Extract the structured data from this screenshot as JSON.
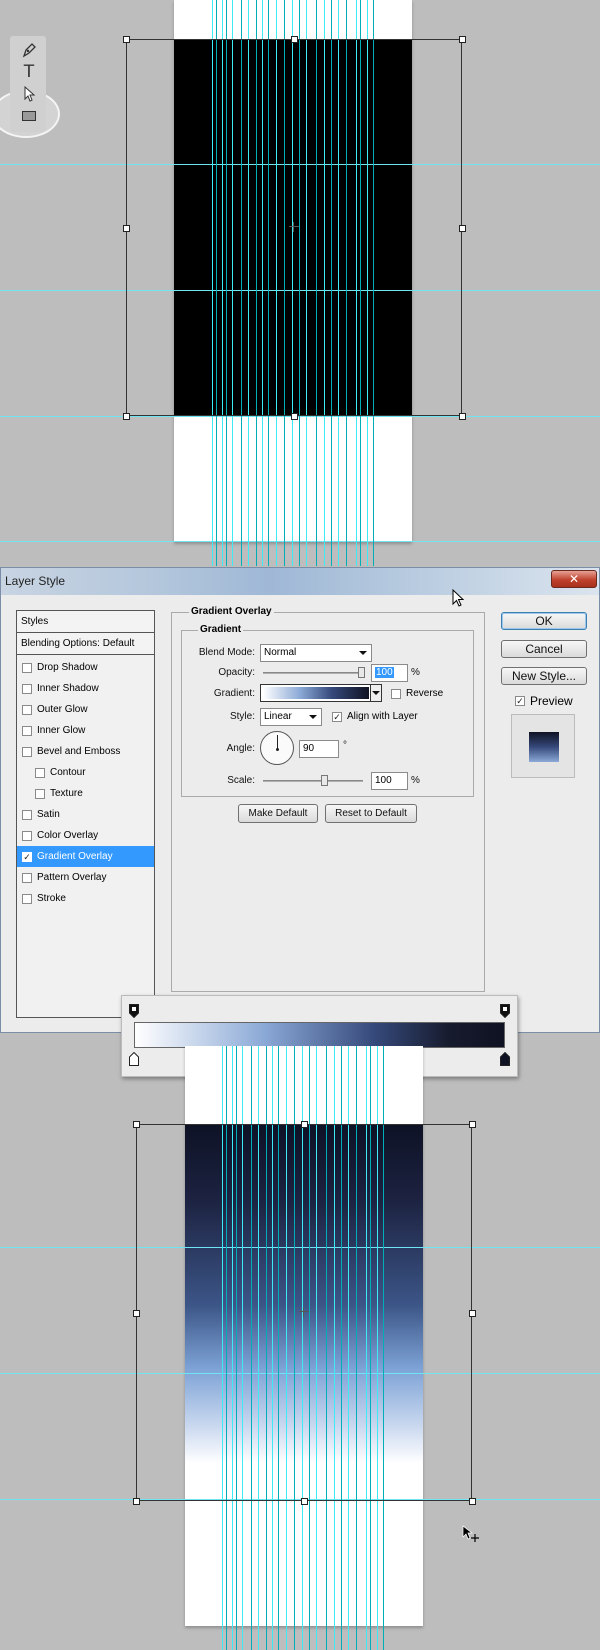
{
  "dialog": {
    "title": "Layer Style",
    "close_glyph": "✕",
    "styles_header": "Styles",
    "blending_header": "Blending Options: Default",
    "style_items": [
      {
        "label": "Drop Shadow",
        "checked": false,
        "selected": false,
        "sub": false
      },
      {
        "label": "Inner Shadow",
        "checked": false,
        "selected": false,
        "sub": false
      },
      {
        "label": "Outer Glow",
        "checked": false,
        "selected": false,
        "sub": false
      },
      {
        "label": "Inner Glow",
        "checked": false,
        "selected": false,
        "sub": false
      },
      {
        "label": "Bevel and Emboss",
        "checked": false,
        "selected": false,
        "sub": false
      },
      {
        "label": "Contour",
        "checked": false,
        "selected": false,
        "sub": true
      },
      {
        "label": "Texture",
        "checked": false,
        "selected": false,
        "sub": true
      },
      {
        "label": "Satin",
        "checked": false,
        "selected": false,
        "sub": false
      },
      {
        "label": "Color Overlay",
        "checked": false,
        "selected": false,
        "sub": false
      },
      {
        "label": "Gradient Overlay",
        "checked": true,
        "selected": true,
        "sub": false
      },
      {
        "label": "Pattern Overlay",
        "checked": false,
        "selected": false,
        "sub": false
      },
      {
        "label": "Stroke",
        "checked": false,
        "selected": false,
        "sub": false
      }
    ],
    "panel_title": "Gradient Overlay",
    "group_title": "Gradient",
    "blend_mode_label": "Blend Mode:",
    "blend_mode_value": "Normal",
    "opacity_label": "Opacity:",
    "opacity_value": "100",
    "percent": "%",
    "gradient_label": "Gradient:",
    "reverse_label": "Reverse",
    "reverse_checked": false,
    "style_label": "Style:",
    "style_value": "Linear",
    "align_label": "Align with Layer",
    "align_checked": true,
    "angle_label": "Angle:",
    "angle_value": "90",
    "degree": "°",
    "scale_label": "Scale:",
    "scale_value": "100",
    "make_default": "Make Default",
    "reset_default": "Reset to Default",
    "ok": "OK",
    "cancel": "Cancel",
    "new_style": "New Style...",
    "preview_label": "Preview",
    "preview_checked": true
  },
  "tools": [
    "pen-icon",
    "type-icon",
    "path-selection-icon",
    "rectangle-icon"
  ],
  "colors": {
    "guide": "#3eebf5",
    "selection_blue": "#3399ff",
    "gradient_dark": "#0f1222",
    "gradient_mid": "#8ba9d6",
    "gradient_light": "#ffffff"
  },
  "gradient_stops": {
    "color_stop_colors": [
      "#ffffff",
      "#6f8fc2",
      "#35497a",
      "#0f1222"
    ],
    "opacity_stop_count": 2
  }
}
